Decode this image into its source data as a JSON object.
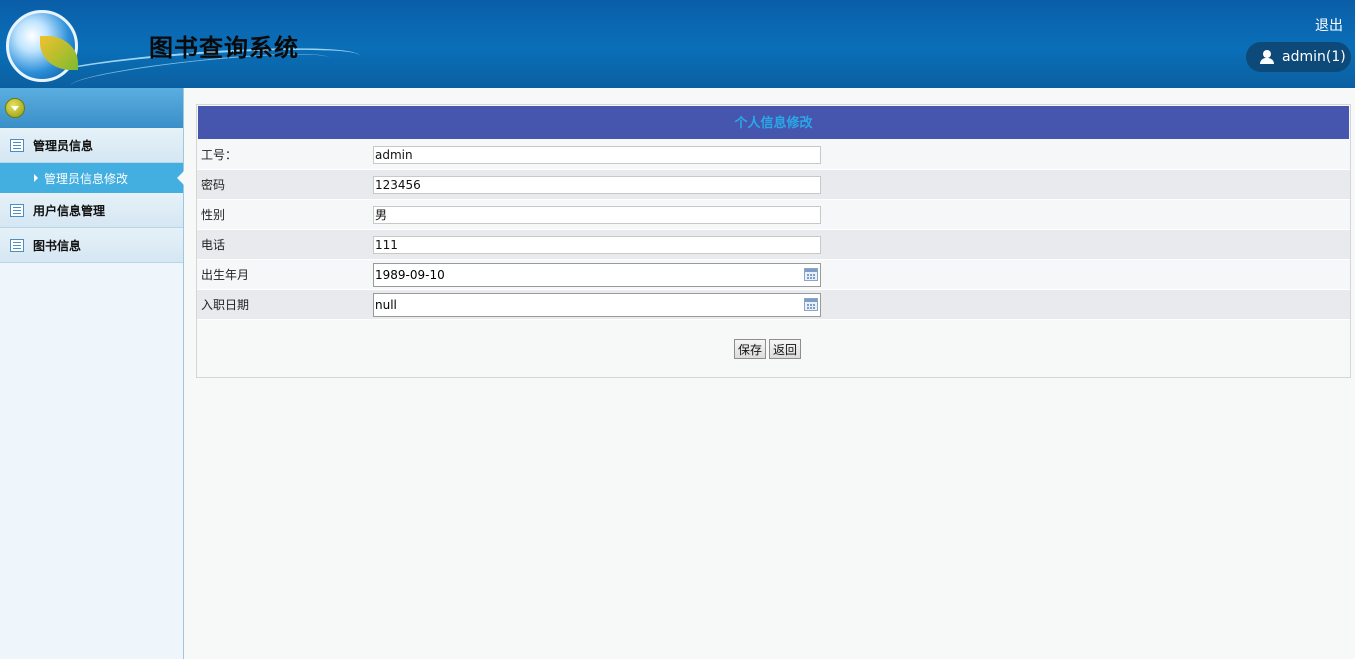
{
  "header": {
    "title": "图书查询系统",
    "logout_label": "退出",
    "user_label": "admin(1)"
  },
  "sidebar": {
    "items": [
      {
        "label": "管理员信息",
        "sub": [
          {
            "label": "管理员信息修改"
          }
        ]
      },
      {
        "label": "用户信息管理"
      },
      {
        "label": "图书信息"
      }
    ]
  },
  "form": {
    "title": "个人信息修改",
    "fields": [
      {
        "label": "工号：",
        "value": "admin"
      },
      {
        "label": "密码",
        "value": "123456"
      },
      {
        "label": "性别",
        "value": "男"
      },
      {
        "label": "电话",
        "value": "111"
      },
      {
        "label": "出生年月",
        "value": "1989-09-10"
      },
      {
        "label": "入职日期",
        "value": "null"
      }
    ],
    "save_label": "保存",
    "back_label": "返回"
  },
  "colors": {
    "header_bg": "#0a6fb8",
    "form_title_bg": "#4655ae",
    "form_title_text": "#2aa8e6",
    "active_menu_bg": "#43aee0"
  }
}
